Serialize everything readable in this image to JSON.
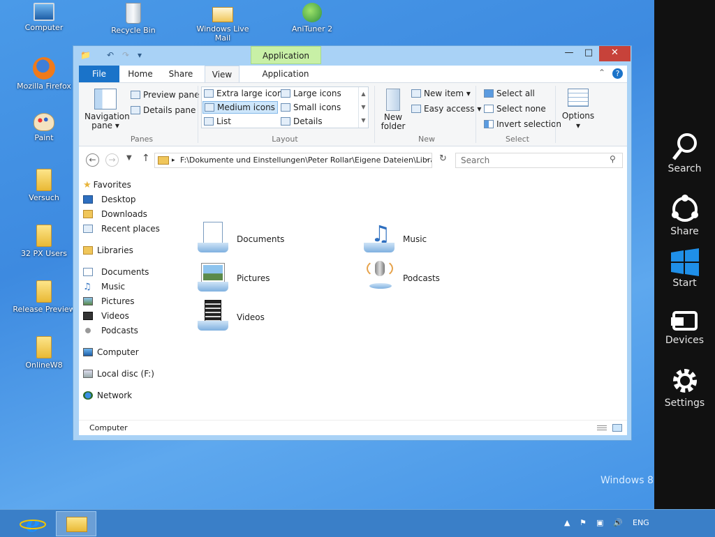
{
  "desktop": {
    "icons": [
      "Computer",
      "Recycle Bin",
      "Windows Live Mail",
      "AniTuner 2",
      "Mozilla Firefox",
      "Paint",
      "Versuch",
      "32 PX Users",
      "Release Preview",
      "OnlineW8"
    ],
    "watermark": "Windows 8"
  },
  "charms": [
    "Search",
    "Share",
    "Start",
    "Devices",
    "Settings"
  ],
  "window": {
    "context_tab": "Application Tools",
    "tabs": [
      "File",
      "Home",
      "Share",
      "View",
      "Application"
    ],
    "ribbon": {
      "panes": {
        "navigation_pane": "Navigation pane",
        "preview_pane": "Preview pane",
        "details_pane": "Details pane",
        "group": "Panes"
      },
      "layout": {
        "items": [
          "Extra large icons",
          "Large icons",
          "Medium icons",
          "Small icons",
          "List",
          "Details"
        ],
        "group": "Layout",
        "selected": "Medium icons"
      },
      "new": {
        "new_folder": "New folder",
        "new_item": "New item",
        "easy_access": "Easy access",
        "group": "New"
      },
      "select": {
        "select_all": "Select all",
        "select_none": "Select none",
        "invert_selection": "Invert selection",
        "group": "Select"
      },
      "options": "Options"
    },
    "address": "F:\\Dokumente und Einstellungen\\Peter Rollar\\Eigene Dateien\\Libra",
    "search_placeholder": "Search",
    "nav": {
      "favorites": "Favorites",
      "favorites_items": [
        "Desktop",
        "Downloads",
        "Recent places"
      ],
      "libraries": "Libraries",
      "libraries_items": [
        "Documents",
        "Music",
        "Pictures",
        "Videos",
        "Podcasts"
      ],
      "computer": "Computer",
      "local_disc": "Local disc (F:)",
      "network": "Network"
    },
    "content": [
      "Documents",
      "Music",
      "Pictures",
      "Podcasts",
      "Videos"
    ],
    "status": "Computer"
  },
  "taskbar": {
    "lang": "ENG"
  },
  "colors": {
    "file_tab": "#1a73c9",
    "close": "#c7423a",
    "context_tab": "#c8f0a6",
    "charms_bg": "#111111"
  }
}
